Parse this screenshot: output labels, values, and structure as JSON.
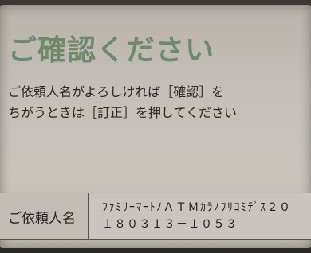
{
  "screen": {
    "title": "ご確認ください",
    "message_line1": "ご依頼人名がよろしければ［確認］を",
    "message_line2": "ちがうときは［訂正］を押してください"
  },
  "requester": {
    "label": "ご依頼人名",
    "value_line1": "ﾌｧﾐﾘｰﾏｰﾄﾉＡＴＭｶﾗﾉﾌﾘｺﾐﾃﾞｽ２０",
    "value_line2": "１８０３１３－１０５３"
  }
}
